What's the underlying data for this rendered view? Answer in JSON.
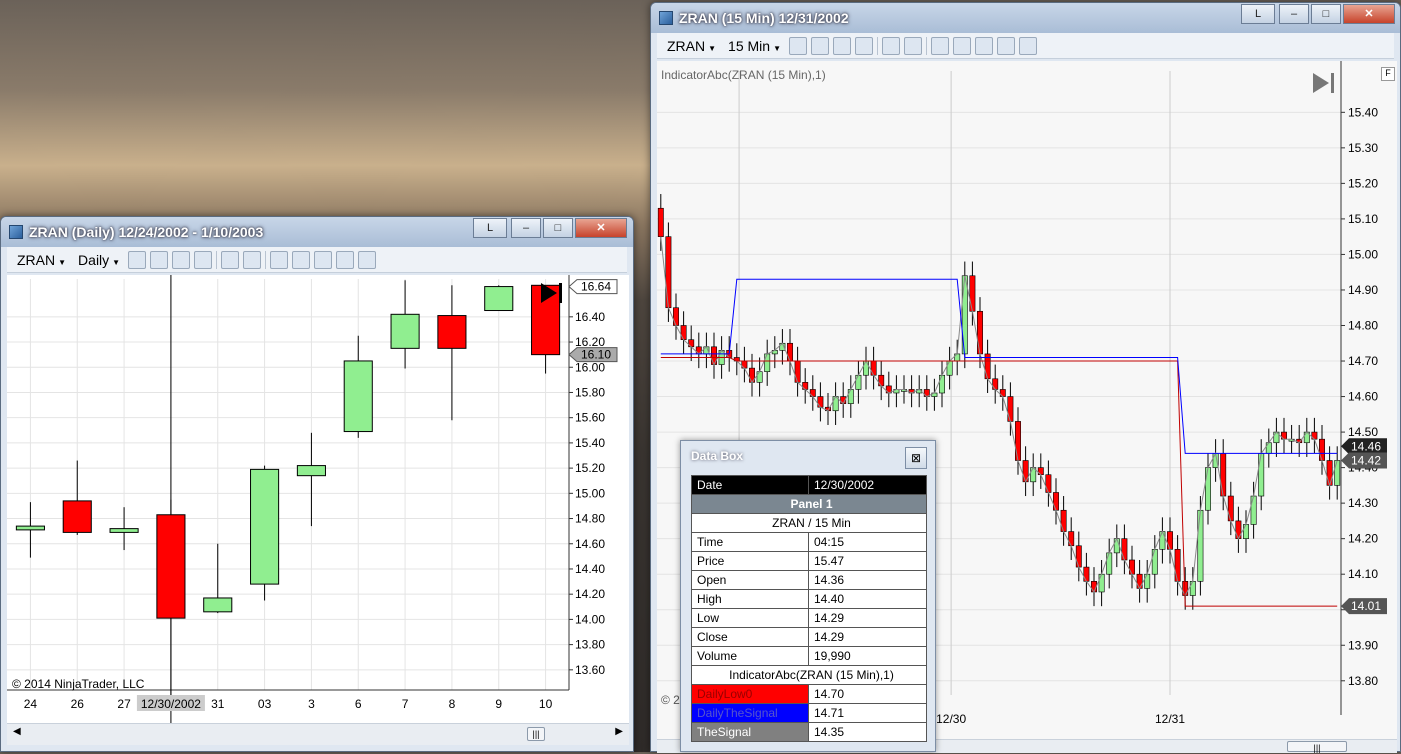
{
  "daily_window": {
    "title": "ZRAN (Daily)  12/24/2002 - 1/10/2003",
    "buttons": {
      "lock": "L",
      "minimize": "–",
      "maximize": "□",
      "close": "✕"
    },
    "toolbar": {
      "instrument": "ZRAN",
      "interval": "Daily"
    },
    "copyright": "© 2014 NinjaTrader, LLC",
    "price_tags": {
      "top": "16.64",
      "mid": "16.10"
    },
    "scroll_grip": "|||"
  },
  "intraday_window": {
    "title": "ZRAN (15 Min)  12/31/2002",
    "buttons": {
      "lock": "L",
      "minimize": "–",
      "maximize": "□",
      "close": "✕"
    },
    "toolbar": {
      "instrument": "ZRAN",
      "interval": "15 Min"
    },
    "indicator_label": "IndicatorAbc(ZRAN (15 Min),1)",
    "f_button": "F",
    "copyright_partial": "© 2",
    "price_tags": [
      "14.46",
      "14.42",
      "14.01"
    ],
    "x_labels": [
      "12/30",
      "12/31"
    ],
    "scroll_grip": "|||"
  },
  "colors": {
    "up": "#90ee90",
    "down": "#ff0000",
    "signal": "#0000ff",
    "low": "#c00000",
    "grid": "#e4e4e4"
  },
  "chart_data": [
    {
      "type": "candlestick",
      "title": "ZRAN (Daily)  12/24/2002 - 1/10/2003",
      "x": [
        "24",
        "26",
        "27",
        "12/30/2002",
        "31",
        "03",
        "3",
        "6",
        "7",
        "8",
        "9",
        "10"
      ],
      "open": [
        14.71,
        14.94,
        14.69,
        14.83,
        14.06,
        14.28,
        15.14,
        15.49,
        16.15,
        16.41,
        16.45,
        16.65
      ],
      "high": [
        14.93,
        15.26,
        14.89,
        14.95,
        14.6,
        15.22,
        15.48,
        16.25,
        16.69,
        16.65,
        16.65,
        16.65
      ],
      "low": [
        14.49,
        14.67,
        14.55,
        13.0,
        14.05,
        14.15,
        14.74,
        15.44,
        15.99,
        15.58,
        16.45,
        15.95
      ],
      "close": [
        14.74,
        14.69,
        14.72,
        14.01,
        14.17,
        15.19,
        15.22,
        16.05,
        16.42,
        16.15,
        16.64,
        16.1
      ],
      "ylim": [
        13.44,
        16.7
      ],
      "yticks": [
        "16.40",
        "16.20",
        "16.00",
        "15.80",
        "15.60",
        "15.40",
        "15.20",
        "15.00",
        "14.80",
        "14.60",
        "14.40",
        "14.20",
        "14.00",
        "13.80",
        "13.60"
      ]
    },
    {
      "type": "candlestick",
      "title": "ZRAN (15 Min)  12/31/2002",
      "ylim": [
        13.76,
        15.46
      ],
      "yticks": [
        "15.40",
        "15.30",
        "15.20",
        "15.10",
        "15.00",
        "14.90",
        "14.80",
        "14.70",
        "14.60",
        "14.50",
        "14.40",
        "14.30",
        "14.20",
        "14.10",
        "14.00",
        "13.90",
        "13.80"
      ],
      "close": [
        15.05,
        14.85,
        14.8,
        14.76,
        14.74,
        14.72,
        14.74,
        14.69,
        14.73,
        14.71,
        14.7,
        14.68,
        14.64,
        14.67,
        14.72,
        14.73,
        14.75,
        14.7,
        14.64,
        14.62,
        14.6,
        14.57,
        14.56,
        14.6,
        14.58,
        14.62,
        14.66,
        14.7,
        14.66,
        14.63,
        14.61,
        14.62,
        14.62,
        14.61,
        14.62,
        14.6,
        14.61,
        14.66,
        14.7,
        14.72,
        14.94,
        14.84,
        14.72,
        14.65,
        14.62,
        14.6,
        14.53,
        14.42,
        14.36,
        14.4,
        14.38,
        14.33,
        14.28,
        14.22,
        14.18,
        14.12,
        14.08,
        14.05,
        14.1,
        14.16,
        14.2,
        14.14,
        14.1,
        14.06,
        14.1,
        14.17,
        14.22,
        14.17,
        14.08,
        14.04,
        14.08,
        14.28,
        14.4,
        14.44,
        14.32,
        14.25,
        14.2,
        14.24,
        14.32,
        14.44,
        14.47,
        14.5,
        14.48,
        14.48,
        14.47,
        14.5,
        14.48,
        14.42,
        14.35,
        14.42
      ],
      "series": [
        {
          "name": "DailyLow0",
          "values": [
            14.71,
            14.71,
            14.71,
            14.71,
            14.71,
            14.71,
            14.71,
            14.71,
            14.71,
            14.71,
            14.7,
            14.7,
            14.7,
            14.7,
            14.7,
            14.7,
            14.7,
            14.7,
            14.7,
            14.7,
            14.7,
            14.7,
            14.7,
            14.7,
            14.7,
            14.7,
            14.7,
            14.7,
            14.7,
            14.7,
            14.7,
            14.7,
            14.7,
            14.7,
            14.7,
            14.7,
            14.7,
            14.7,
            14.7,
            14.7,
            14.7,
            14.7,
            14.7,
            14.7,
            14.7,
            14.7,
            14.7,
            14.7,
            14.7,
            14.7,
            14.7,
            14.7,
            14.7,
            14.7,
            14.7,
            14.7,
            14.7,
            14.7,
            14.7,
            14.7,
            14.7,
            14.7,
            14.7,
            14.7,
            14.7,
            14.7,
            14.7,
            14.7,
            14.7,
            14.01,
            14.01,
            14.01,
            14.01,
            14.01,
            14.01,
            14.01,
            14.01,
            14.01,
            14.01,
            14.01,
            14.01,
            14.01,
            14.01,
            14.01,
            14.01,
            14.01,
            14.01,
            14.01,
            14.01,
            14.01
          ]
        },
        {
          "name": "DailyTheSignal",
          "values": [
            14.72,
            14.72,
            14.72,
            14.72,
            14.72,
            14.72,
            14.72,
            14.72,
            14.72,
            14.72,
            14.93,
            14.93,
            14.93,
            14.93,
            14.93,
            14.93,
            14.93,
            14.93,
            14.93,
            14.93,
            14.93,
            14.93,
            14.93,
            14.93,
            14.93,
            14.93,
            14.93,
            14.93,
            14.93,
            14.93,
            14.93,
            14.93,
            14.93,
            14.93,
            14.93,
            14.93,
            14.93,
            14.93,
            14.93,
            14.93,
            14.71,
            14.71,
            14.71,
            14.71,
            14.71,
            14.71,
            14.71,
            14.71,
            14.71,
            14.71,
            14.71,
            14.71,
            14.71,
            14.71,
            14.71,
            14.71,
            14.71,
            14.71,
            14.71,
            14.71,
            14.71,
            14.71,
            14.71,
            14.71,
            14.71,
            14.71,
            14.71,
            14.71,
            14.71,
            14.44,
            14.44,
            14.44,
            14.44,
            14.44,
            14.44,
            14.44,
            14.44,
            14.44,
            14.44,
            14.44,
            14.44,
            14.44,
            14.44,
            14.44,
            14.44,
            14.44,
            14.44,
            14.44,
            14.44,
            14.44
          ]
        }
      ]
    }
  ],
  "databox": {
    "title": "Data Box",
    "close": "⊠",
    "date_label": "Date",
    "date_value": "12/30/2002",
    "panel": "Panel 1",
    "instrument": "ZRAN / 15 Min",
    "rows": [
      [
        "Time",
        "04:15"
      ],
      [
        "Price",
        "15.47"
      ],
      [
        "Open",
        "14.36"
      ],
      [
        "High",
        "14.40"
      ],
      [
        "Low",
        "14.29"
      ],
      [
        "Close",
        "14.29"
      ],
      [
        "Volume",
        "19,990"
      ]
    ],
    "indicator": "IndicatorAbc(ZRAN (15 Min),1)",
    "plots": [
      [
        "DailyLow0",
        "14.70"
      ],
      [
        "DailyTheSignal",
        "14.71"
      ],
      [
        "TheSignal",
        "14.35"
      ]
    ]
  }
}
